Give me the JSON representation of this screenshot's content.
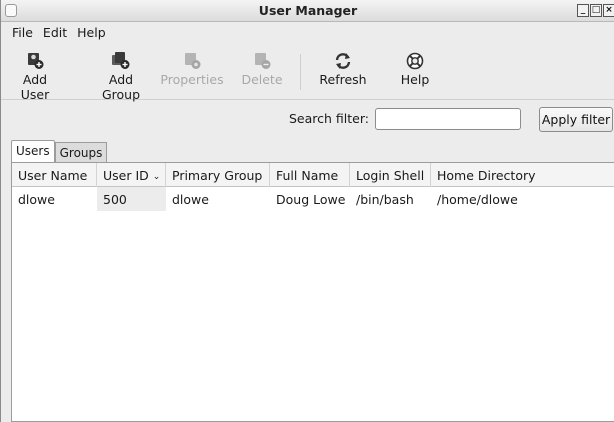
{
  "window": {
    "title": "User Manager",
    "controls": [
      "_",
      "□",
      "×"
    ]
  },
  "menubar": {
    "items": [
      "File",
      "Edit",
      "Help"
    ]
  },
  "toolbar": {
    "add_user": "Add User",
    "add_group": "Add Group",
    "properties": "Properties",
    "delete": "Delete",
    "refresh": "Refresh",
    "help": "Help"
  },
  "search": {
    "label": "Search filter:",
    "value": "",
    "apply_label": "Apply filter"
  },
  "tabs": [
    {
      "label": "Users",
      "active": true
    },
    {
      "label": "Groups",
      "active": false
    }
  ],
  "table": {
    "columns": [
      "User Name",
      "User ID",
      "Primary Group",
      "Full Name",
      "Login Shell",
      "Home Directory"
    ],
    "sort_indicator": "⌄",
    "rows": [
      {
        "user_name": "dlowe",
        "user_id": "500",
        "primary_group": "dlowe",
        "full_name": "Doug Lowe",
        "login_shell": "/bin/bash",
        "home_directory": "/home/dlowe"
      }
    ]
  },
  "icons": [
    "app-icon",
    "add-user-icon",
    "add-group-icon",
    "properties-icon",
    "delete-icon",
    "refresh-icon",
    "help-icon"
  ]
}
